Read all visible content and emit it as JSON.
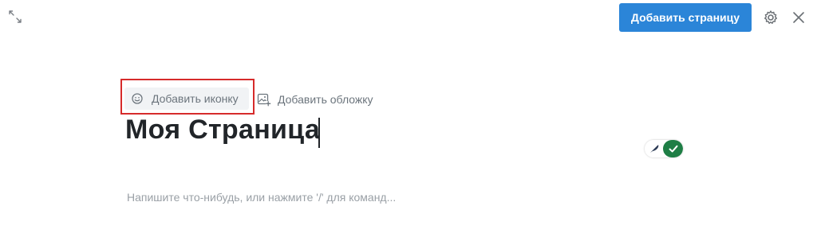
{
  "header": {
    "add_page_label": "Добавить страницу"
  },
  "page_meta_actions": {
    "add_icon_label": "Добавить иконку",
    "add_cover_label": "Добавить обложку"
  },
  "editor": {
    "title": "Моя Страница",
    "body_placeholder": "Напишите что-нибудь, или нажмите '/' для команд..."
  },
  "toggle": {
    "state": "on",
    "on_color": "#1e7e45"
  },
  "colors": {
    "primary_button": "#2b85d8",
    "highlight": "#d62b2b",
    "muted_text": "#6c757d",
    "placeholder_text": "#9aa0a6"
  },
  "icons": [
    "expand-icon",
    "gear-icon",
    "close-icon",
    "smiley-icon",
    "image-add-icon",
    "feather-icon",
    "check-icon"
  ]
}
